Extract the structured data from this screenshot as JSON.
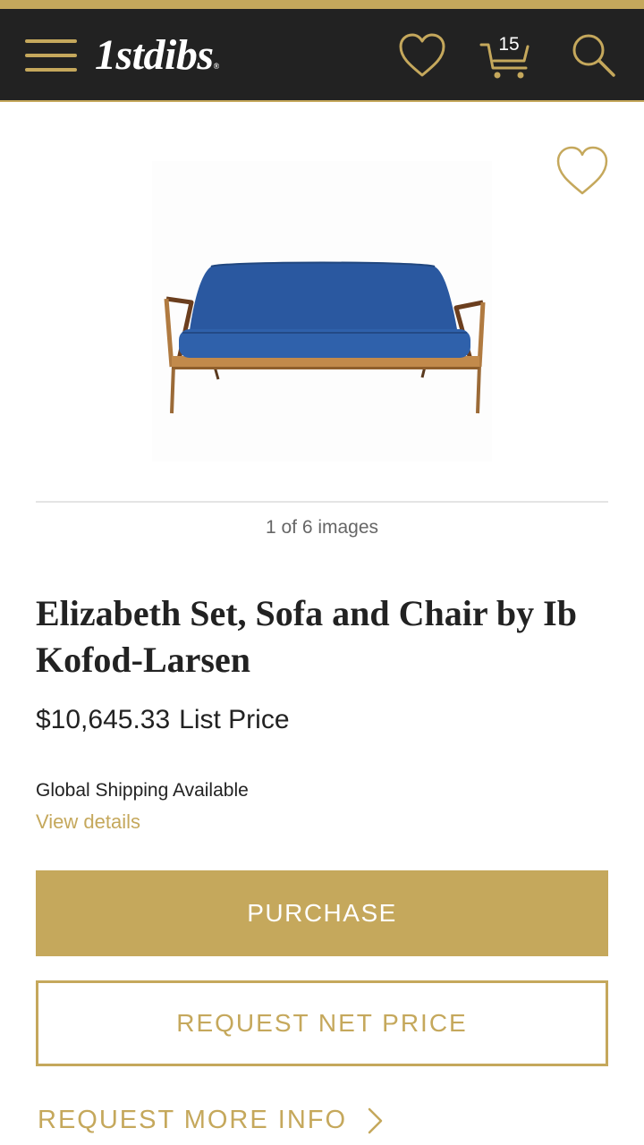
{
  "header": {
    "logo_text": "1stdibs",
    "logo_mark": "®",
    "cart_count": "15",
    "icons": [
      "menu-icon",
      "heart-icon",
      "cart-icon",
      "search-icon"
    ]
  },
  "gallery": {
    "image_counter": "1 of 6 images",
    "image_subject": "blue-sofa-image"
  },
  "product": {
    "title": "Elizabeth Set, Sofa and Chair by Ib Kofod-Larsen",
    "price": "$10,645.33",
    "price_label": "List Price",
    "shipping_text": "Global Shipping Available",
    "shipping_link": "View details"
  },
  "actions": {
    "purchase_label": "PURCHASE",
    "net_price_label": "REQUEST NET PRICE",
    "more_info_label": "REQUEST MORE INFO"
  },
  "colors": {
    "gold": "#c5a85c",
    "header_bg": "#222222",
    "sofa_blue": "#2a58a0"
  }
}
